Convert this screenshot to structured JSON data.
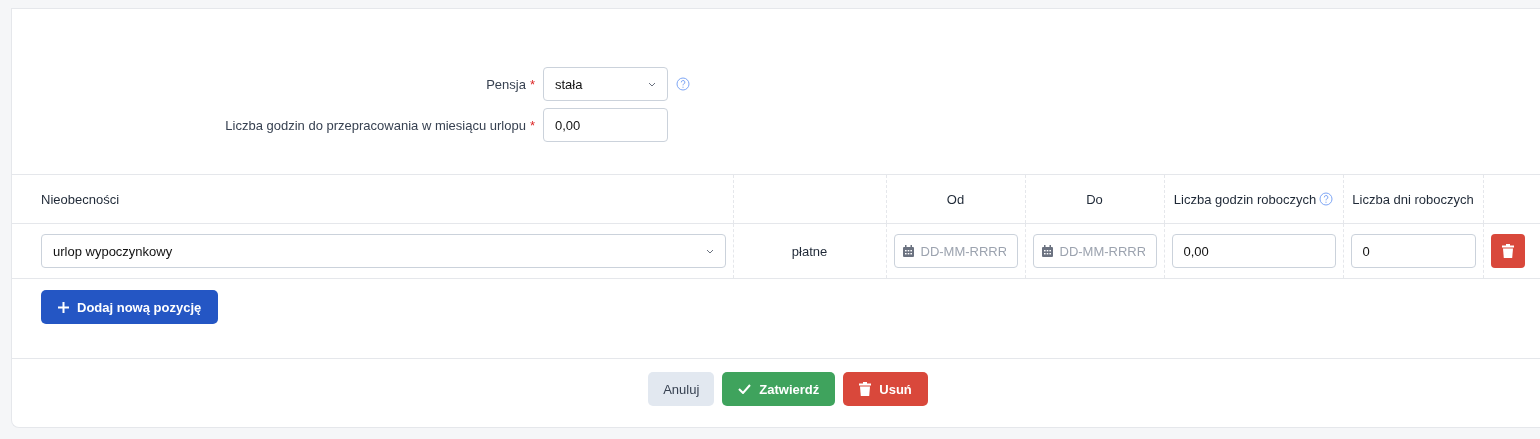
{
  "form": {
    "fields": [
      {
        "kind": "select",
        "label": "Pensja",
        "required_mark": "*",
        "value": "stała",
        "help": true
      },
      {
        "kind": "input",
        "label": "Liczba godzin do przepracowania w miesiącu urlopu",
        "required_mark": "*",
        "value": "0,00",
        "help": false
      }
    ]
  },
  "absences": {
    "columns": [
      {
        "label": "Nieobecności",
        "help": false
      },
      {
        "help": false
      },
      {
        "label": "Od",
        "help": false
      },
      {
        "label": "Do",
        "help": false
      },
      {
        "label": "Liczba godzin roboczych",
        "help": true
      },
      {
        "label": "Liczba dni roboczych",
        "help": false
      }
    ],
    "rows": [
      {
        "type": "urlop wypoczynkowy",
        "paid": "płatne",
        "from_placeholder": "DD-MM-RRRR",
        "to_placeholder": "DD-MM-RRRR",
        "hours": "0,00",
        "days": "0"
      }
    ],
    "add_button": "Dodaj nową pozycję"
  },
  "footer": {
    "buttons": [
      {
        "kind": "cancel",
        "label": "Anuluj"
      },
      {
        "kind": "confirm",
        "label": "Zatwierdź"
      },
      {
        "kind": "delete",
        "label": "Usuń"
      }
    ]
  }
}
